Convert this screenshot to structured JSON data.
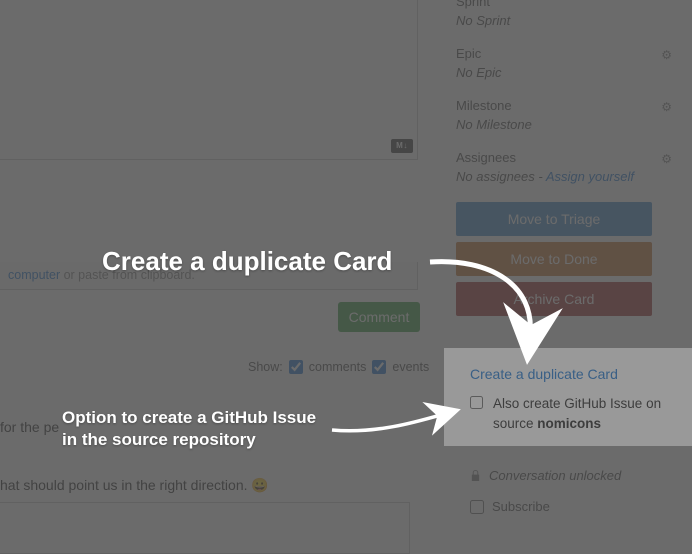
{
  "sidebar": {
    "sprint": {
      "heading": "Sprint",
      "value": "No Sprint"
    },
    "epic": {
      "heading": "Epic",
      "value": "No Epic"
    },
    "milestone": {
      "heading": "Milestone",
      "value": "No Milestone"
    },
    "assignees": {
      "heading": "Assignees",
      "value_prefix": "No assignees - ",
      "assign_self": "Assign yourself"
    },
    "actions": {
      "triage": "Move to Triage",
      "done": "Move to Done",
      "archive": "Archive Card"
    },
    "lock_text": "Conversation unlocked",
    "subscribe": "Subscribe"
  },
  "duplicate_popover": {
    "title": "Create a duplicate Card",
    "checkbox_text_before": "Also create GitHub Issue on source ",
    "repo_name": "nomicons"
  },
  "main": {
    "md_badge": "M↓",
    "attach_link": "computer",
    "attach_suffix": " or paste from clipboard.",
    "comment_btn": "Comment",
    "show_label": "Show:",
    "show_comments": "comments",
    "show_events": "events",
    "thread1_fragment": " for the pe",
    "thread2_fragment": "hat should point us in the right direction. 😀",
    "emoji": "😀"
  },
  "callouts": {
    "top": "Create a duplicate Card",
    "bottom_line1": "Option to create a GitHub Issue",
    "bottom_line2": "in the source repository"
  }
}
